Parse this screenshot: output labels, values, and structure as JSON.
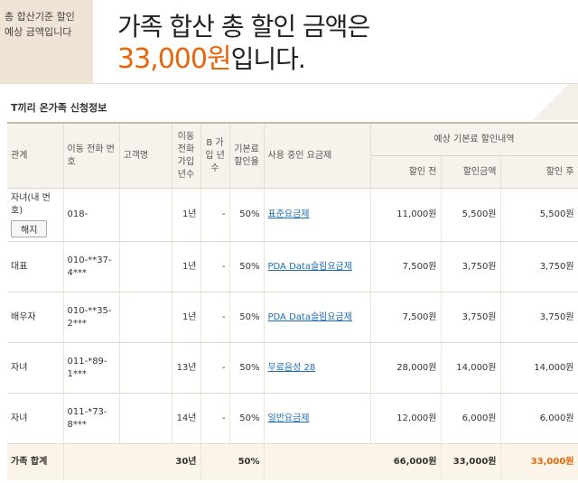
{
  "banner": {
    "label_line1": "총 합산기준 할인",
    "label_line2": "예상 금액입니다",
    "headline": "가족 합산 총 할인 금액은",
    "amount": "33,000원",
    "amount_suffix": "입니다.",
    "accent_color": "#e8650a"
  },
  "section": {
    "title": "T끼리 온가족 신청정보"
  },
  "table": {
    "headers": {
      "relation": "관계",
      "phone": "이동 전화 번호",
      "customer": "고객명",
      "join_years": "이동 전화 가입 년수",
      "b_years": "B 가입 년수",
      "base_rate": "기본료 할인율",
      "plan": "사용 중인 요금제",
      "expected": "예상 기본료 할인내역",
      "before": "할인 전",
      "discount": "할인금액",
      "after": "할인 후"
    },
    "rows": [
      {
        "relation": "자녀(내 번호)",
        "phone": "018-",
        "customer": "",
        "join_years": "1년",
        "b_years": "-",
        "base_rate": "50%",
        "plan": "표준요금제",
        "before": "11,000원",
        "discount": "5,500원",
        "after": "5,500원",
        "button": "해지"
      },
      {
        "relation": "대표",
        "phone": "010-**37-4***",
        "customer": "",
        "join_years": "1년",
        "b_years": "-",
        "base_rate": "50%",
        "plan": "PDA Data슬림요금제",
        "before": "7,500원",
        "discount": "3,750원",
        "after": "3,750원"
      },
      {
        "relation": "배우자",
        "phone": "010-**35-2***",
        "customer": "",
        "join_years": "1년",
        "b_years": "-",
        "base_rate": "50%",
        "plan": "PDA Data슬림요금제",
        "before": "7,500원",
        "discount": "3,750원",
        "after": "3,750원"
      },
      {
        "relation": "자녀",
        "phone": "011-*89-1***",
        "customer": "",
        "join_years": "13년",
        "b_years": "-",
        "base_rate": "50%",
        "plan": "무료음성 28",
        "before": "28,000원",
        "discount": "14,000원",
        "after": "14,000원"
      },
      {
        "relation": "자녀",
        "phone": "011-*73-8***",
        "customer": "",
        "join_years": "14년",
        "b_years": "-",
        "base_rate": "50%",
        "plan": "일반요금제",
        "before": "12,000원",
        "discount": "6,000원",
        "after": "6,000원"
      }
    ],
    "total": {
      "label": "가족 합계",
      "join_years": "30년",
      "base_rate": "50%",
      "before": "66,000원",
      "discount": "33,000원",
      "after": "33,000원"
    }
  }
}
